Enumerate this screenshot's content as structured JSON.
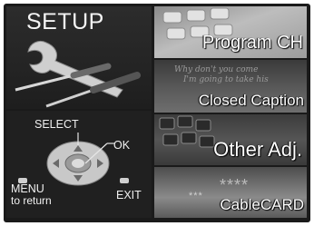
{
  "setup_panel": {
    "title": "SETUP",
    "select_label": "SELECT",
    "ok_label": "OK",
    "menu_label": "MENU",
    "menu_sub_label": "to return",
    "exit_label": "EXIT"
  },
  "menu_tiles": [
    {
      "label": "Program CH",
      "icon": "remote-keypad-icon"
    },
    {
      "label": "Closed Caption",
      "icon": "caption-text-icon",
      "background_text": [
        "Why don't you come",
        "I'm going to take his"
      ]
    },
    {
      "label": "Other Adj.",
      "icon": "keyboard-keys-icon"
    },
    {
      "label": "CableCARD",
      "icon": "card-stars-icon",
      "stars_large": "****",
      "stars_small": "***"
    }
  ]
}
